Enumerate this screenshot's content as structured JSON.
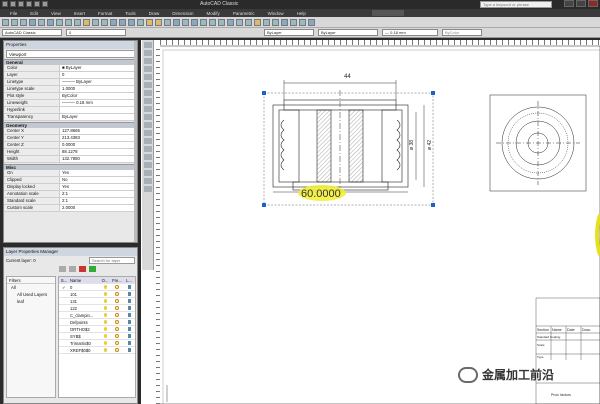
{
  "titlebar": {
    "title": "AutoCAD Classic",
    "search_placeholder": "Type a keyword or phrase"
  },
  "menubar": {
    "items": [
      "File",
      "Edit",
      "View",
      "Insert",
      "Format",
      "Tools",
      "Draw",
      "Dimension",
      "Modify",
      "Parametric",
      "Window",
      "Help"
    ]
  },
  "toolbar2": {
    "workspace": "AutoCAD Classic",
    "layer": "0",
    "color": "ByLayer",
    "linetype": "ByLayer",
    "lineweight": "— 0.18 mm",
    "plotstyle": "ByColor"
  },
  "properties": {
    "title": "Properties",
    "object": "Viewport",
    "general_header": "General",
    "general": [
      {
        "k": "Color",
        "v": "■ ByLayer"
      },
      {
        "k": "Layer",
        "v": "0"
      },
      {
        "k": "Linetype",
        "v": "——— ByLayer"
      },
      {
        "k": "Linetype scale",
        "v": "1.0000"
      },
      {
        "k": "Plot style",
        "v": "ByColor"
      },
      {
        "k": "Lineweight",
        "v": "——— 0.18 mm"
      },
      {
        "k": "Hyperlink",
        "v": ""
      },
      {
        "k": "Transparency",
        "v": "ByLayer"
      }
    ],
    "geometry_header": "Geometry",
    "geometry": [
      {
        "k": "Center X",
        "v": "127.8665"
      },
      {
        "k": "Center Y",
        "v": "213.4383"
      },
      {
        "k": "Center Z",
        "v": "0.0000"
      },
      {
        "k": "Height",
        "v": "88.1278"
      },
      {
        "k": "Width",
        "v": "132.7880"
      }
    ],
    "misc_header": "Misc",
    "misc": [
      {
        "k": "On",
        "v": "Yes"
      },
      {
        "k": "Clipped",
        "v": "No"
      },
      {
        "k": "Display locked",
        "v": "Yes"
      },
      {
        "k": "Annotation scale",
        "v": "2:1"
      },
      {
        "k": "Standard scale",
        "v": "2:1"
      },
      {
        "k": "Custom scale",
        "v": "2.0000"
      }
    ]
  },
  "layers": {
    "title": "Layer Properties Manager",
    "current": "Current layer: 0",
    "search_placeholder": "Search for layer",
    "filters_header": "Filters",
    "tree": [
      "All",
      "All Used Layers",
      "leaf"
    ],
    "columns": {
      "s": "S...",
      "name": "Name",
      "on": "O...",
      "freeze": "Fre...",
      "lock": "L..."
    },
    "rows": [
      {
        "s": "✔",
        "name": "0"
      },
      {
        "s": "",
        "name": "101"
      },
      {
        "s": "",
        "name": "131"
      },
      {
        "s": "",
        "name": "122"
      },
      {
        "s": "",
        "name": "C_clampin..."
      },
      {
        "s": "",
        "name": "Defpoints"
      },
      {
        "s": "",
        "name": "ORTHO$2"
      },
      {
        "s": "",
        "name": "SYB$"
      },
      {
        "s": "",
        "name": "Trimatrix$0"
      },
      {
        "s": "",
        "name": "XREF$0$0"
      }
    ]
  },
  "drawing": {
    "dim_top": "44",
    "dim_bottom": "60.0000",
    "dim_right_a": "ø 42",
    "dim_right_b": "ø 38",
    "title_block_headers": [
      "Section",
      "Name",
      "Date",
      "Docu"
    ],
    "title_block_rows": [
      [
        "Standard Coating",
        "",
        "",
        ""
      ],
      [
        "Scale",
        "",
        "",
        ""
      ],
      [
        "Type",
        "",
        "",
        ""
      ]
    ],
    "prod_label": "Prod. factors"
  },
  "watermark": {
    "text": "金属加工前沿"
  }
}
